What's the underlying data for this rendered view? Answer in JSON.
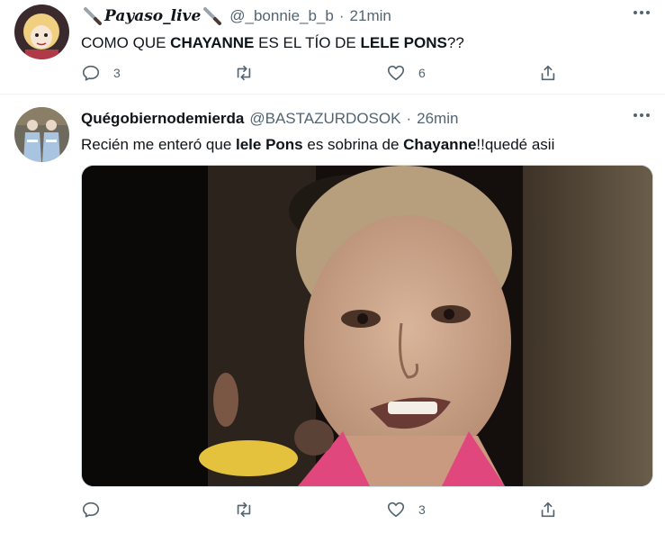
{
  "tweets": [
    {
      "display_name": "Payaso_live",
      "handle": "@_bonnie_b_b",
      "separator": "·",
      "time": "21min",
      "text_parts": [
        "COMO QUE ",
        "CHAYANNE",
        " ES EL TÍO DE ",
        "LELE PONS",
        "??"
      ],
      "replies": "3",
      "retweets": "",
      "likes": "6"
    },
    {
      "display_name": "Quégobiernodemierda",
      "handle": "@BASTAZURDOSOK",
      "separator": "·",
      "time": "26min",
      "text_parts": [
        "Recién me enteró que ",
        "lele Pons",
        " es sobrina de ",
        "Chayanne",
        "!!quedé asii"
      ],
      "replies": "",
      "retweets": "",
      "likes": "3"
    }
  ],
  "icons": {
    "more": "more-icon",
    "reply": "reply-icon",
    "retweet": "retweet-icon",
    "like": "like-icon",
    "share": "share-icon",
    "knife": "knife-emoji-icon"
  },
  "colors": {
    "secondary_text": "#536471",
    "primary_text": "#0f1419",
    "divider": "#eff3f4"
  }
}
